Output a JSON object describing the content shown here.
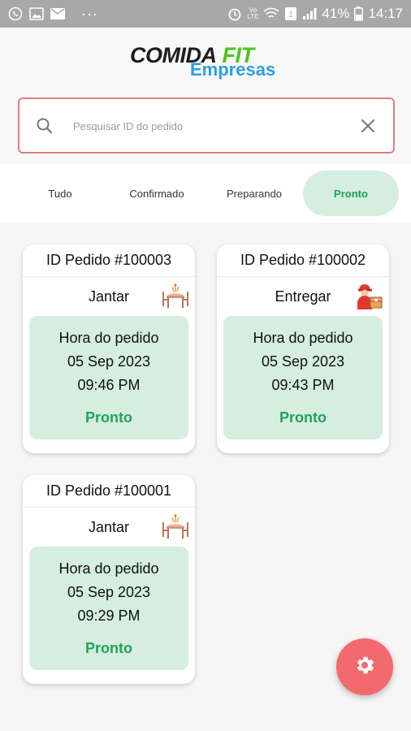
{
  "status_bar": {
    "battery": "41%",
    "time": "14:17",
    "dots": "···",
    "icons": [
      "whatsapp-icon",
      "image-icon",
      "mail-icon",
      "alarm-icon",
      "volte-icon",
      "wifi-icon",
      "sim-icon",
      "signal-icon",
      "battery-icon"
    ]
  },
  "header": {
    "logo_part1": "CO",
    "logo_part2": "MIDA",
    "logo_part3": "FIT",
    "logo_sub": "Empresas"
  },
  "search": {
    "placeholder": "Pesquisar ID do pedido",
    "value": ""
  },
  "tabs": [
    {
      "label": "Tudo",
      "active": false
    },
    {
      "label": "Confirmado",
      "active": false
    },
    {
      "label": "Preparando",
      "active": false
    },
    {
      "label": "Pronto",
      "active": true
    }
  ],
  "orders": [
    {
      "id": "ID Pedido #100003",
      "type": "Jantar",
      "type_icon": "dinner-table-icon",
      "time_label": "Hora do pedido",
      "date": "05 Sep 2023",
      "time": "09:46 PM",
      "status": "Pronto"
    },
    {
      "id": "ID Pedido #100002",
      "type": "Entregar",
      "type_icon": "delivery-man-icon",
      "time_label": "Hora do pedido",
      "date": "05 Sep 2023",
      "time": "09:43 PM",
      "status": "Pronto"
    },
    {
      "id": "ID Pedido #100001",
      "type": "Jantar",
      "type_icon": "dinner-table-icon",
      "time_label": "Hora do pedido",
      "date": "05 Sep 2023",
      "time": "09:29 PM",
      "status": "Pronto"
    }
  ],
  "colors": {
    "accent_green": "#22a35a",
    "card_body": "#d5eedf",
    "search_border": "#e57d7d",
    "fab": "#f36a6e",
    "logo_blue": "#2b9fe6",
    "logo_green": "#46c81e"
  },
  "fab": {
    "icon": "settings-gear-icon"
  }
}
